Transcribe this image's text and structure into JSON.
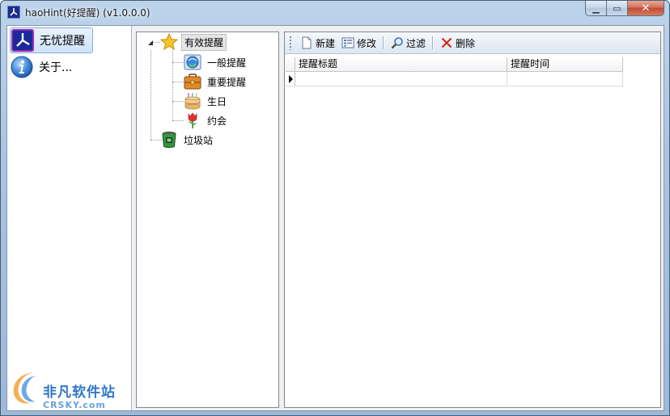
{
  "window": {
    "title": "haoHint(好提醒) (v1.0.0.0)",
    "min_symbol": "▁",
    "max_symbol": "▭",
    "close_symbol": "✕"
  },
  "sidebar": {
    "items": [
      {
        "label": "无忧提醒",
        "icon": "clock-icon",
        "selected": true
      },
      {
        "label": "关于...",
        "icon": "info-icon",
        "selected": false
      }
    ]
  },
  "tree": {
    "root": {
      "label": "有效提醒",
      "icon": "star-icon"
    },
    "children": [
      {
        "label": "一般提醒",
        "icon": "globe-icon"
      },
      {
        "label": "重要提醒",
        "icon": "briefcase-icon"
      },
      {
        "label": "生日",
        "icon": "cake-icon"
      },
      {
        "label": "约会",
        "icon": "flower-icon"
      }
    ],
    "trash": {
      "label": "垃圾站",
      "icon": "trash-icon"
    }
  },
  "toolbar": {
    "new_label": "新建",
    "edit_label": "修改",
    "filter_label": "过滤",
    "delete_label": "删除"
  },
  "grid": {
    "columns": [
      "提醒标题",
      "提醒时间"
    ],
    "rows": [
      [
        "",
        ""
      ]
    ]
  },
  "watermark": {
    "cn": "非凡软件站",
    "en": "CRSKY.com"
  },
  "colors": {
    "selection": "#cfe3fb",
    "close_button": "#c24a32",
    "watermark_blue": "#2f76c8"
  }
}
